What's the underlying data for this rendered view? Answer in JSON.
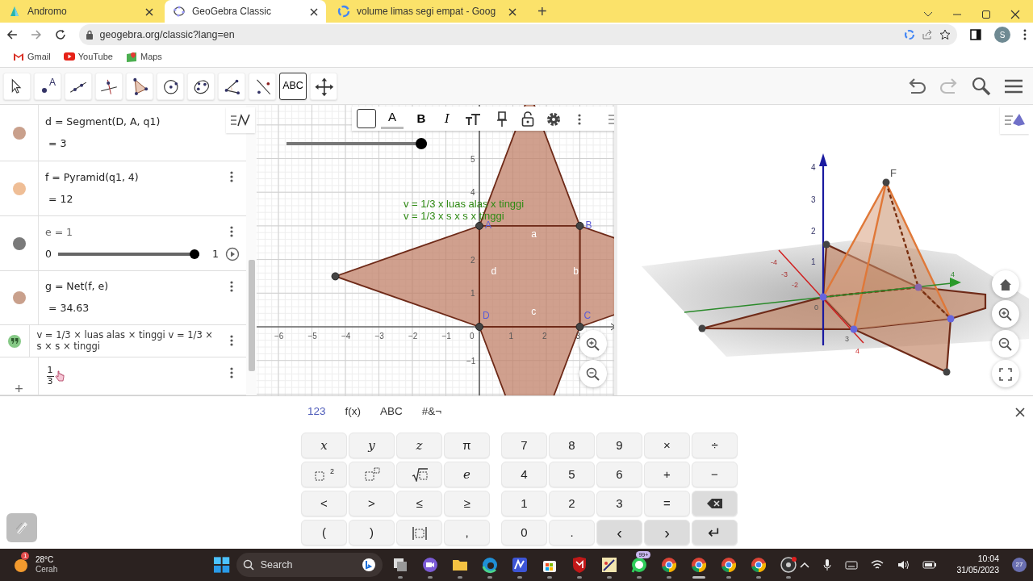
{
  "browser": {
    "tabs": [
      {
        "title": "Andromo",
        "selected": false,
        "kind": "andromo"
      },
      {
        "title": "GeoGebra Classic",
        "selected": true,
        "kind": "geogebra"
      },
      {
        "title": "volume limas segi empat - Goog",
        "selected": false,
        "kind": "google"
      }
    ],
    "new_tab": "+",
    "address": "geogebra.org/classic?lang=en",
    "profile": "S",
    "bookmarks": [
      {
        "label": "Gmail",
        "kind": "gmail"
      },
      {
        "label": "YouTube",
        "kind": "youtube"
      },
      {
        "label": "Maps",
        "kind": "maps"
      }
    ]
  },
  "toolbar": {
    "tools": [
      {
        "kind": "pointer",
        "selected": false
      },
      {
        "kind": "point",
        "label": "A",
        "selected": false
      },
      {
        "kind": "line",
        "selected": false
      },
      {
        "kind": "perpendicular",
        "selected": false
      },
      {
        "kind": "polygon",
        "selected": false
      },
      {
        "kind": "circle",
        "selected": false
      },
      {
        "kind": "conic",
        "selected": false
      },
      {
        "kind": "angle",
        "selected": false
      },
      {
        "kind": "reflect",
        "selected": false
      },
      {
        "kind": "text",
        "label": "ABC",
        "selected": true
      },
      {
        "kind": "move",
        "selected": false
      }
    ]
  },
  "algebra": {
    "items": [
      {
        "kind": "formula",
        "color": "#c9a08c",
        "definition": "d = Segment(D, A, q1)",
        "value": "= 3",
        "menu": false
      },
      {
        "kind": "formula",
        "color": "#efbe96",
        "definition": "f = Pyramid(q1, 4)",
        "value": "= 12",
        "menu": true
      },
      {
        "kind": "slider",
        "color": "#7a7a7a",
        "definition": "e = 1",
        "min": "0",
        "max": "1",
        "level": 1,
        "menu": true
      },
      {
        "kind": "formula",
        "color": "#c9a08c",
        "definition": "g = Net(f, e)",
        "value": "= 34.63",
        "menu": true
      },
      {
        "kind": "text",
        "color": "#86c986",
        "text": "v = 1/3 × luas alas × tinggi v = 1/3 × s × s × tinggi",
        "menu": true
      },
      {
        "kind": "input",
        "numerator": "1",
        "denominator": "3",
        "menu": true
      }
    ],
    "add": "+"
  },
  "graphics": {
    "slider": {
      "level": 1
    },
    "style_bar": [
      "A",
      "B",
      "I"
    ],
    "texts": [
      "v = 1/3 x luas alas x tinggi",
      "v = 1/3 x s x s x tinggi"
    ],
    "points": [
      "A",
      "B",
      "D",
      "C"
    ],
    "segments": [
      "a",
      "b",
      "c",
      "d"
    ],
    "x_ticks": [
      "−6",
      "−5",
      "−4",
      "−3",
      "−2",
      "−1",
      "0",
      "1",
      "2",
      "3"
    ],
    "y_ticks": [
      "5",
      "4",
      "2",
      "1",
      "−1"
    ]
  },
  "graphics3d": {
    "labels": [
      "F",
      "4",
      "3",
      "2",
      "1",
      "-4",
      "-3",
      "-2",
      "4",
      "0",
      "3",
      "4"
    ]
  },
  "keyboard": {
    "tabs": [
      {
        "label": "123",
        "selected": true
      },
      {
        "label": "f(x)",
        "selected": false
      },
      {
        "label": "ABC",
        "selected": false
      },
      {
        "label": "#&¬",
        "selected": false
      }
    ],
    "rows": [
      {
        "left": [
          {
            "kind": "var",
            "label": "x"
          },
          {
            "kind": "var",
            "label": "y"
          },
          {
            "kind": "var",
            "label": "z"
          },
          {
            "kind": "char",
            "label": "π"
          }
        ],
        "right": [
          {
            "kind": "char",
            "label": "7"
          },
          {
            "kind": "char",
            "label": "8"
          },
          {
            "kind": "char",
            "label": "9"
          },
          {
            "kind": "char",
            "label": "×"
          },
          {
            "kind": "char",
            "label": "÷"
          }
        ]
      },
      {
        "left": [
          {
            "kind": "square",
            "sup": "2"
          },
          {
            "kind": "power"
          },
          {
            "kind": "sqrt"
          },
          {
            "kind": "var",
            "label": "e"
          }
        ],
        "right": [
          {
            "kind": "char",
            "label": "4"
          },
          {
            "kind": "char",
            "label": "5"
          },
          {
            "kind": "char",
            "label": "6"
          },
          {
            "kind": "char",
            "label": "+"
          },
          {
            "kind": "char",
            "label": "−"
          }
        ]
      },
      {
        "left": [
          {
            "kind": "char",
            "label": "<"
          },
          {
            "kind": "char",
            "label": ">"
          },
          {
            "kind": "char",
            "label": "≤"
          },
          {
            "kind": "char",
            "label": "≥"
          }
        ],
        "right": [
          {
            "kind": "char",
            "label": "1"
          },
          {
            "kind": "char",
            "label": "2"
          },
          {
            "kind": "char",
            "label": "3"
          },
          {
            "kind": "char",
            "label": "="
          },
          {
            "kind": "delete"
          }
        ]
      },
      {
        "left": [
          {
            "kind": "char",
            "label": "("
          },
          {
            "kind": "char",
            "label": ")"
          },
          {
            "kind": "abs"
          },
          {
            "kind": "char",
            "label": ","
          }
        ],
        "right": [
          {
            "kind": "char",
            "label": "0"
          },
          {
            "kind": "char",
            "label": "."
          },
          {
            "kind": "action",
            "label": "‹"
          },
          {
            "kind": "action",
            "label": "›"
          },
          {
            "kind": "action",
            "label": "↵"
          }
        ]
      }
    ]
  },
  "taskbar": {
    "weather": {
      "temp": "28°C",
      "condition": "Cerah",
      "badge": "1"
    },
    "search": "Search",
    "apps": [
      {
        "kind": "taskview",
        "active": false
      },
      {
        "kind": "meet",
        "active": false
      },
      {
        "kind": "folder",
        "active": false
      },
      {
        "kind": "edge",
        "active": false
      },
      {
        "kind": "editor",
        "active": false
      },
      {
        "kind": "store",
        "active": false
      },
      {
        "kind": "shield",
        "active": false
      },
      {
        "kind": "paint",
        "active": false
      },
      {
        "kind": "whatsapp",
        "active": false,
        "badge": "99+"
      },
      {
        "kind": "chrome",
        "active": false
      },
      {
        "kind": "chrome",
        "active": true
      },
      {
        "kind": "chrome",
        "active": false
      },
      {
        "kind": "chrome",
        "active": false
      },
      {
        "kind": "obs",
        "active": false
      }
    ],
    "time": "10:04",
    "date": "31/05/2023",
    "notifications": "27"
  }
}
